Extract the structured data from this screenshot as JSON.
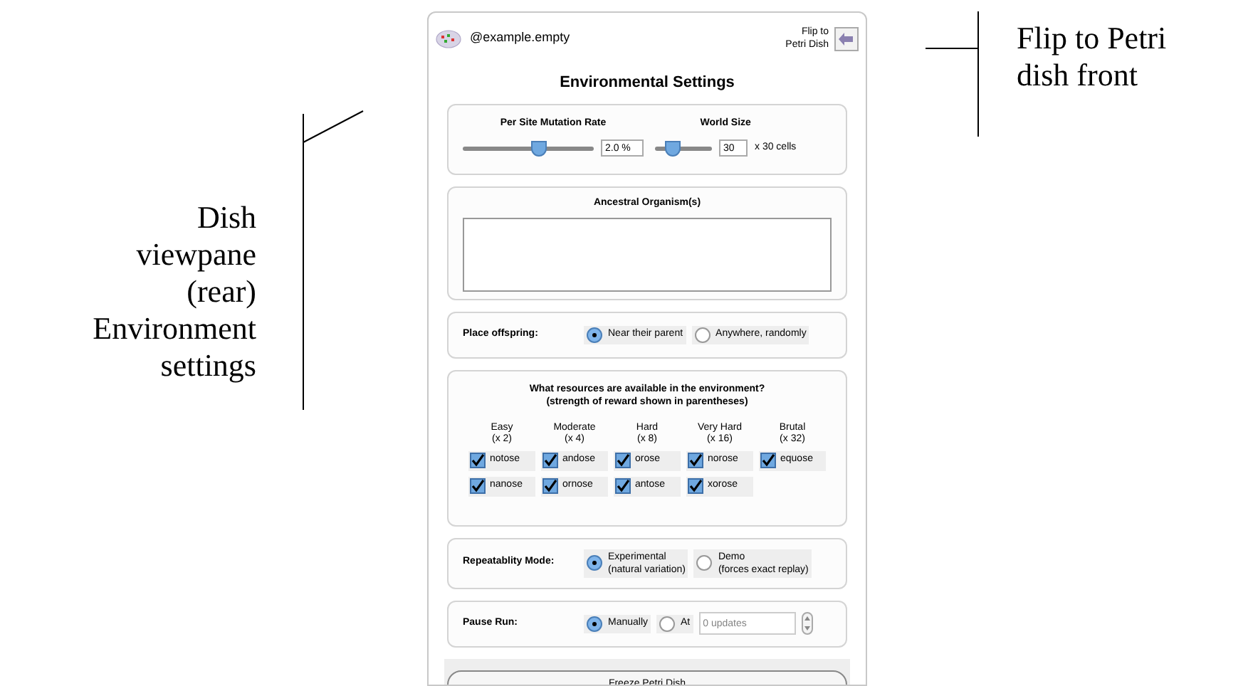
{
  "annotations": {
    "left": {
      "lines": [
        "Dish",
        "viewpane",
        "(rear)",
        "Environment",
        "settings"
      ]
    },
    "right": {
      "lines": [
        "Flip to Petri",
        "dish front"
      ]
    }
  },
  "header": {
    "dish_name": "@example.empty",
    "flip_lines": [
      "Flip to",
      "Petri Dish"
    ]
  },
  "title": "Environmental Settings",
  "sliders": [
    {
      "label": "Per Site Mutation Rate",
      "level": 0.58,
      "value": "2.0 %"
    },
    {
      "label": "World Size",
      "level": 0.3,
      "value": "30",
      "suffix": "x 30 cells"
    }
  ],
  "ancestors": {
    "label": "Ancestral Organism(s)"
  },
  "place_offspring": {
    "label": "Place offspring:",
    "options": [
      {
        "text": "Near their parent",
        "selected": true
      },
      {
        "text": "Anywhere, randomly",
        "selected": false
      }
    ]
  },
  "resources": {
    "question": "What resources are available in the environment?",
    "note": "(strength of reward shown in parentheses)",
    "columns": [
      {
        "name": "Easy",
        "reward": "(x 2)",
        "items": [
          {
            "name": "notose",
            "checked": true
          },
          {
            "name": "nanose",
            "checked": true
          }
        ]
      },
      {
        "name": "Moderate",
        "reward": "(x 4)",
        "items": [
          {
            "name": "andose",
            "checked": true
          },
          {
            "name": "ornose",
            "checked": true
          }
        ]
      },
      {
        "name": "Hard",
        "reward": "(x 8)",
        "items": [
          {
            "name": "orose",
            "checked": true
          },
          {
            "name": "antose",
            "checked": true
          }
        ]
      },
      {
        "name": "Very Hard",
        "reward": "(x 16)",
        "items": [
          {
            "name": "norose",
            "checked": true
          },
          {
            "name": "xorose",
            "checked": true
          }
        ]
      },
      {
        "name": "Brutal",
        "reward": "(x 32)",
        "items": [
          {
            "name": "equose",
            "checked": true
          }
        ]
      }
    ]
  },
  "repeatability": {
    "label": "Repeatablity Mode:",
    "options": [
      {
        "lines": [
          "Experimental",
          "(natural variation)"
        ],
        "selected": true
      },
      {
        "lines": [
          "Demo",
          "(forces exact replay)"
        ],
        "selected": false
      }
    ]
  },
  "pause_run": {
    "label": "Pause Run:",
    "options": [
      {
        "text": "Manually",
        "selected": true
      },
      {
        "text": "At",
        "selected": false
      }
    ],
    "placeholder": "0 updates"
  },
  "freeze_button": "Freeze Petri Dish"
}
